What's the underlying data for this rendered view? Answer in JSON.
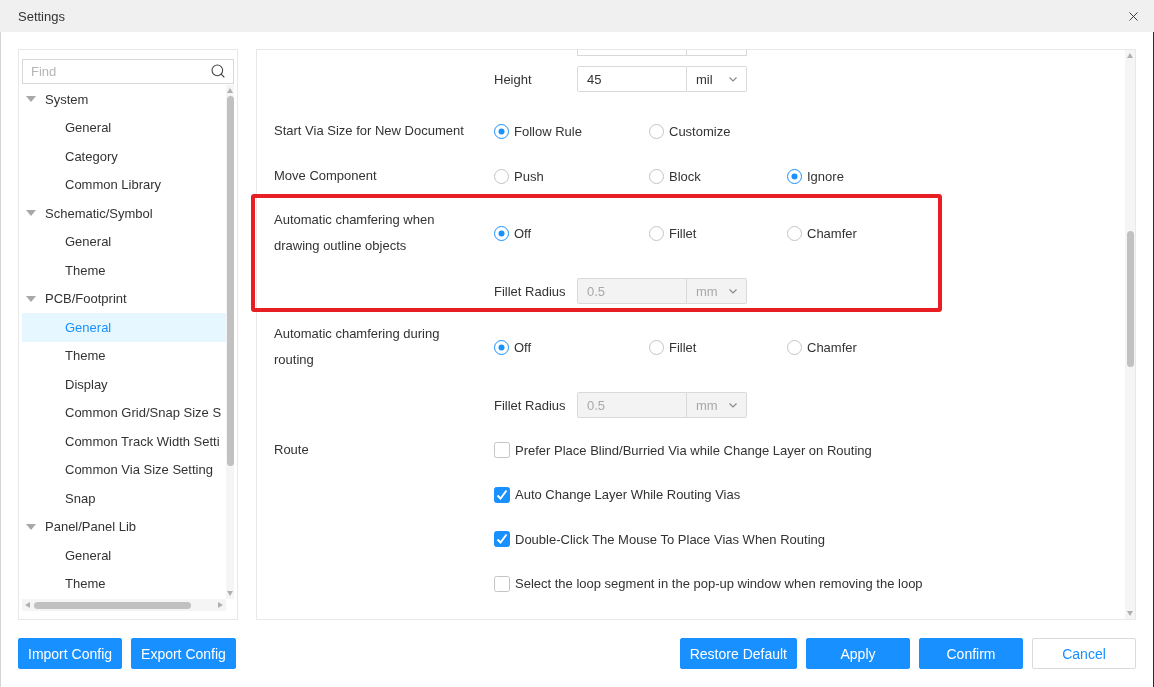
{
  "window": {
    "title": "Settings"
  },
  "sidebar": {
    "search": {
      "placeholder": "Find"
    },
    "tree": [
      {
        "label": "System",
        "expanded": true,
        "selected": false,
        "children": [
          {
            "label": "General",
            "selected": false
          },
          {
            "label": "Category",
            "selected": false
          },
          {
            "label": "Common Library",
            "selected": false
          }
        ]
      },
      {
        "label": "Schematic/Symbol",
        "expanded": true,
        "selected": false,
        "children": [
          {
            "label": "General",
            "selected": false
          },
          {
            "label": "Theme",
            "selected": false
          }
        ]
      },
      {
        "label": "PCB/Footprint",
        "expanded": true,
        "selected": false,
        "children": [
          {
            "label": "General",
            "selected": true
          },
          {
            "label": "Theme",
            "selected": false
          },
          {
            "label": "Display",
            "selected": false
          },
          {
            "label": "Common Grid/Snap Size S",
            "selected": false
          },
          {
            "label": "Common Track Width Setti",
            "selected": false
          },
          {
            "label": "Common Via Size Setting",
            "selected": false
          },
          {
            "label": "Snap",
            "selected": false
          }
        ]
      },
      {
        "label": "Panel/Panel Lib",
        "expanded": true,
        "selected": false,
        "children": [
          {
            "label": "General",
            "selected": false
          },
          {
            "label": "Theme",
            "selected": false
          }
        ]
      }
    ]
  },
  "settings": [
    {
      "kind": "size",
      "label": "Height",
      "value": "45",
      "unit": "mil",
      "disabled": false
    },
    {
      "kind": "radio",
      "label": "Start Via Size for New Document",
      "highlighted": false,
      "options": [
        {
          "label": "Follow Rule",
          "selected": true
        },
        {
          "label": "Customize",
          "selected": false
        }
      ]
    },
    {
      "kind": "radio",
      "label": "Move Component",
      "highlighted": false,
      "options": [
        {
          "label": "Push",
          "selected": false
        },
        {
          "label": "Block",
          "selected": false
        },
        {
          "label": "Ignore",
          "selected": true
        }
      ]
    },
    {
      "kind": "radio",
      "label": "Automatic chamfering when drawing outline objects",
      "highlighted": true,
      "options": [
        {
          "label": "Off",
          "selected": true
        },
        {
          "label": "Fillet",
          "selected": false
        },
        {
          "label": "Chamfer",
          "selected": false
        }
      ],
      "radius": {
        "label": "Fillet Radius",
        "value": "0.5",
        "unit": "mm",
        "disabled": true
      }
    },
    {
      "kind": "radio",
      "label": "Automatic chamfering during routing",
      "highlighted": false,
      "options": [
        {
          "label": "Off",
          "selected": true
        },
        {
          "label": "Fillet",
          "selected": false
        },
        {
          "label": "Chamfer",
          "selected": false
        }
      ],
      "radius": {
        "label": "Fillet Radius",
        "value": "0.5",
        "unit": "mm",
        "disabled": true
      }
    },
    {
      "kind": "checks",
      "label": "Route",
      "highlighted": false,
      "options": [
        {
          "label": "Prefer Place Blind/Burried Via while Change Layer on Routing",
          "checked": false
        },
        {
          "label": "Auto Change Layer While Routing Vias",
          "checked": true
        },
        {
          "label": "Double-Click The Mouse To Place Vias When Routing",
          "checked": true
        },
        {
          "label": "Select the loop segment in the pop-up window when removing the loop",
          "checked": false
        }
      ]
    }
  ],
  "footer": {
    "left": [
      {
        "label": "Import Config",
        "kind": "primary"
      },
      {
        "label": "Export Config",
        "kind": "primary"
      }
    ],
    "right": [
      {
        "label": "Restore Default",
        "kind": "primary"
      },
      {
        "label": "Apply",
        "kind": "primary"
      },
      {
        "label": "Confirm",
        "kind": "primary"
      },
      {
        "label": "Cancel",
        "kind": "default"
      }
    ]
  }
}
